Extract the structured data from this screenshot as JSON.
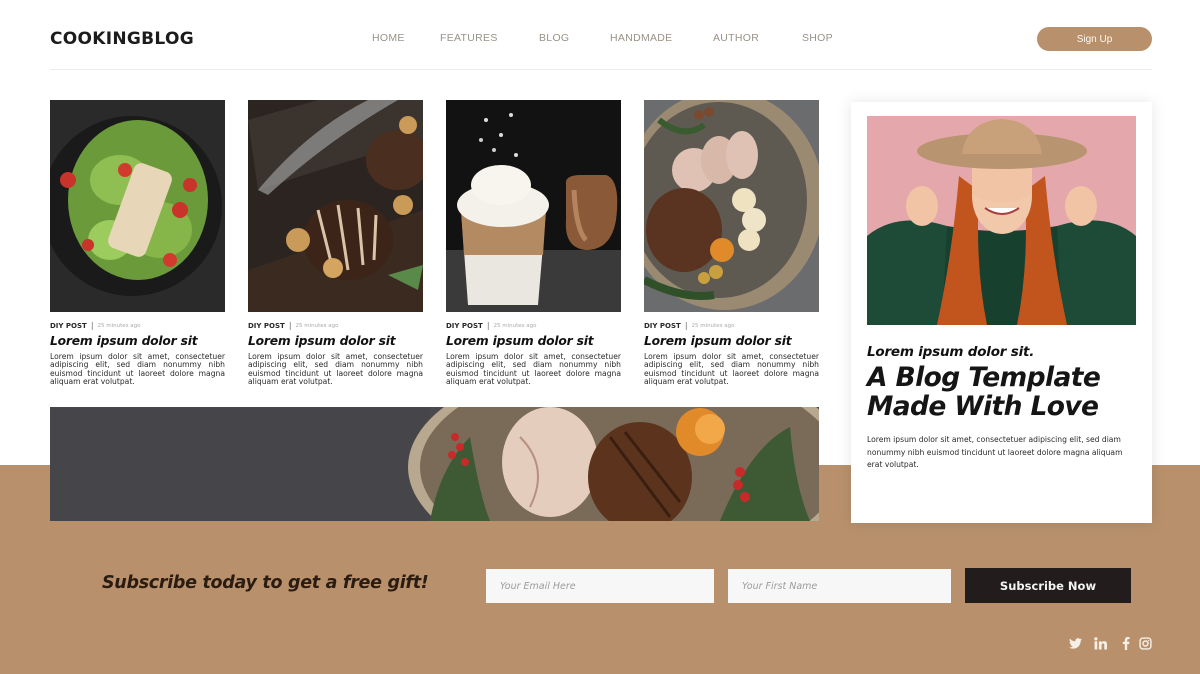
{
  "header": {
    "logo": "COOKINGBLOG",
    "nav": [
      "HOME",
      "FEATURES",
      "BLOG",
      "HANDMADE",
      "AUTHOR",
      "SHOP"
    ],
    "signup_label": "Sign Up"
  },
  "posts": [
    {
      "image": "salad-photo",
      "category": "DIY POST",
      "time": "25 minutes ago",
      "title": "Lorem  ipsum dolor sit",
      "body": "Lorem ipsum dolor sit amet, consectetuer adipiscing elit, sed diam nonummy nibh euismod tincidunt ut laoreet dolore magna aliquam erat volutpat."
    },
    {
      "image": "chocolate-dessert-photo",
      "category": "DIY POST",
      "time": "25 minutes ago",
      "title": "Lorem  ipsum dolor sit",
      "body": "Lorem ipsum dolor sit amet, consectetuer adipiscing elit, sed diam nonummy nibh euismod tincidunt ut laoreet dolore magna aliquam erat volutpat."
    },
    {
      "image": "latte-photo",
      "category": "DIY POST",
      "time": "25 minutes ago",
      "title": "Lorem  ipsum dolor sit",
      "body": "Lorem ipsum dolor sit amet, consectetuer adipiscing elit, sed diam nonummy nibh euismod tincidunt ut laoreet dolore magna aliquam erat volutpat."
    },
    {
      "image": "roast-platter-photo",
      "category": "DIY POST",
      "time": "25 minutes ago",
      "title": "Lorem  ipsum dolor sit",
      "body": "Lorem ipsum dolor sit amet, consectetuer adipiscing elit, sed diam nonummy nibh euismod tincidunt ut laoreet dolore magna aliquam erat volutpat."
    }
  ],
  "feature": {
    "subtitle": "Lorem  ipsum dolor sit.",
    "headline_line1": "A Blog Template",
    "headline_line2": "Made With Love",
    "description": "Lorem ipsum dolor sit amet, consectetuer adipiscing elit, sed diam nonummy nibh euismod tincidunt ut laoreet dolore magna aliquam erat volutpat."
  },
  "subscribe": {
    "cta": "Subscribe today to get a free gift!",
    "email_placeholder": "Your Email Here",
    "email_value": "",
    "name_placeholder": "Your First Name",
    "name_value": "",
    "button_label": "Subscribe Now"
  },
  "social": [
    "twitter-icon",
    "linkedin-icon",
    "facebook-icon",
    "instagram-icon"
  ],
  "colors": {
    "accent": "#b8916c",
    "dark": "#221c1c",
    "text": "#151515",
    "nav_text": "#9a9288"
  }
}
